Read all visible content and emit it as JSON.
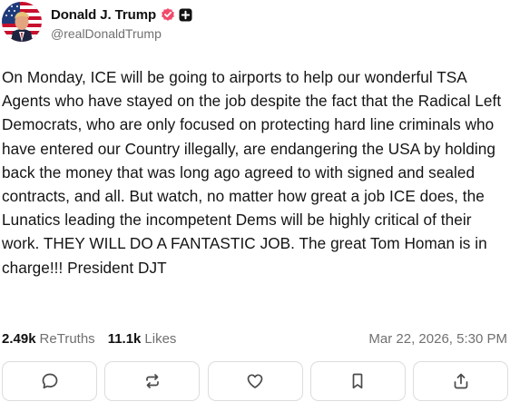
{
  "author": {
    "display_name": "Donald J. Trump",
    "handle": "@realDonaldTrump",
    "avatar_icon": "profile-photo",
    "verified_icon": "verified-badge",
    "verified_color": "#f24a6a",
    "plus_icon": "plus-badge"
  },
  "post": {
    "text": "On Monday, ICE will be going to airports to help our wonderful TSA Agents who have stayed on the job despite the fact that the Radical Left Democrats, who are only focused on protecting hard line criminals who have entered our Country illegally, are endangering the USA by holding back the money that was long ago agreed to with signed and sealed contracts, and all. But watch, no matter how great a job ICE does, the Lunatics leading the incompetent Dems will be highly critical of their work. THEY WILL DO A FANTASTIC JOB. The great Tom Homan is in charge!!! President DJT"
  },
  "stats": {
    "retruths_count": "2.49k",
    "retruths_label": "ReTruths",
    "likes_count": "11.1k",
    "likes_label": "Likes",
    "timestamp": "Mar 22, 2026, 5:30 PM"
  },
  "actions": [
    {
      "name": "reply",
      "icon": "comment-icon"
    },
    {
      "name": "retruth",
      "icon": "repost-icon"
    },
    {
      "name": "like",
      "icon": "heart-icon"
    },
    {
      "name": "bookmark",
      "icon": "bookmark-icon"
    },
    {
      "name": "share",
      "icon": "share-icon"
    }
  ]
}
